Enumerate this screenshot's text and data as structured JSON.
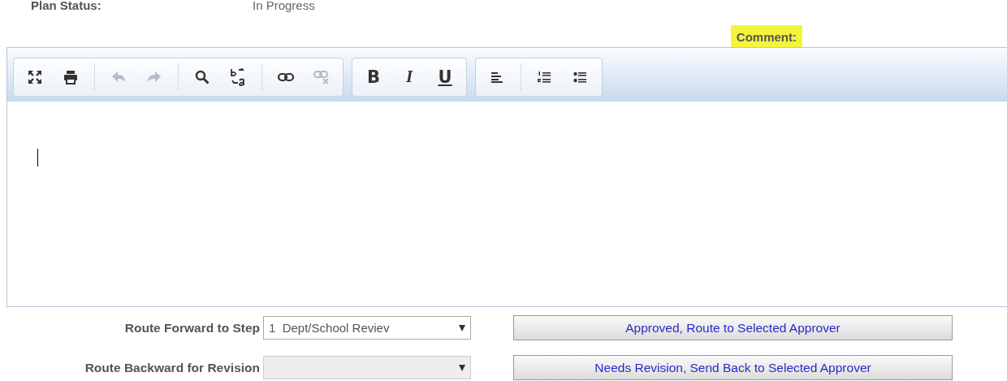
{
  "plan_status": {
    "label": "Plan Status:",
    "value": "In Progress"
  },
  "comment_label": "Comment:",
  "toolbar": [
    [
      {
        "kind": "maximize",
        "disabled": false
      },
      {
        "kind": "print",
        "disabled": false
      },
      {
        "kind": "separator"
      },
      {
        "kind": "undo",
        "disabled": true
      },
      {
        "kind": "redo",
        "disabled": true
      },
      {
        "kind": "separator"
      },
      {
        "kind": "find",
        "disabled": false
      },
      {
        "kind": "replace",
        "disabled": false
      },
      {
        "kind": "separator"
      },
      {
        "kind": "link",
        "disabled": false
      },
      {
        "kind": "unlink",
        "disabled": true
      }
    ],
    [
      {
        "kind": "bold",
        "label": "B",
        "disabled": false
      },
      {
        "kind": "italic",
        "label": "I",
        "disabled": false
      },
      {
        "kind": "underline",
        "label": "U",
        "disabled": false
      }
    ],
    [
      {
        "kind": "align-left",
        "disabled": false
      },
      {
        "kind": "separator"
      },
      {
        "kind": "numbered-list",
        "disabled": false
      },
      {
        "kind": "bulleted-list",
        "disabled": false
      }
    ]
  ],
  "routes": [
    {
      "label": "Route Forward to Step",
      "select": {
        "value": "1  Dept/School Reviev",
        "disabled": false
      },
      "button": "Approved, Route to Selected Approver"
    },
    {
      "label": "Route Backward for Revision",
      "select": {
        "disabled": true
      },
      "button": "Needs Revision, Send Back to Selected Approver"
    }
  ]
}
